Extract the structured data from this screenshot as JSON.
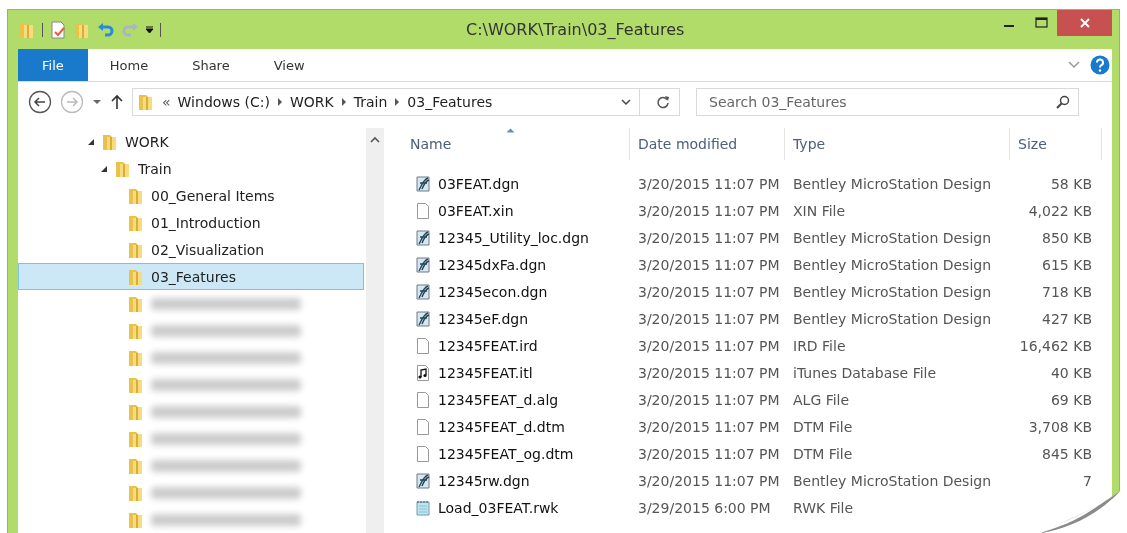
{
  "window": {
    "title": "C:\\WORK\\Train\\03_Features"
  },
  "ribbon": {
    "tabs": [
      {
        "label": "File",
        "selected": true
      },
      {
        "label": "Home",
        "selected": false
      },
      {
        "label": "Share",
        "selected": false
      },
      {
        "label": "View",
        "selected": false
      }
    ]
  },
  "address": {
    "overflow": "«",
    "crumbs": [
      "Windows (C:)",
      "WORK",
      "Train",
      "03_Features"
    ]
  },
  "search": {
    "placeholder": "Search 03_Features"
  },
  "tree": [
    {
      "label": "WORK",
      "expanded": true,
      "selected": false,
      "children": [
        {
          "label": "Train",
          "expanded": true,
          "selected": false,
          "children": [
            {
              "label": "00_General Items",
              "selected": false
            },
            {
              "label": "01_Introduction",
              "selected": false
            },
            {
              "label": "02_Visualization",
              "selected": false
            },
            {
              "label": "03_Features",
              "selected": true
            },
            {
              "kind": "blurred",
              "selected": false
            },
            {
              "kind": "blurred",
              "selected": false
            },
            {
              "kind": "blurred",
              "selected": false
            },
            {
              "kind": "blurred",
              "selected": false
            },
            {
              "kind": "blurred",
              "selected": false
            },
            {
              "kind": "blurred",
              "selected": false
            },
            {
              "kind": "blurred",
              "selected": false
            },
            {
              "kind": "blurred",
              "selected": false
            },
            {
              "kind": "blurred",
              "selected": false
            }
          ]
        }
      ]
    }
  ],
  "files": {
    "columns": [
      {
        "label": "Name",
        "sorted": true
      },
      {
        "label": "Date modified",
        "sorted": false
      },
      {
        "label": "Type",
        "sorted": false
      },
      {
        "label": "Size",
        "sorted": false
      }
    ],
    "rows": [
      {
        "kind": "design",
        "name": "03FEAT.dgn",
        "date": "3/20/2015 11:07 PM",
        "type": "Bentley MicroStation Design",
        "size": "58 KB"
      },
      {
        "kind": "blank",
        "name": "03FEAT.xin",
        "date": "3/20/2015 11:07 PM",
        "type": "XIN File",
        "size": "4,022 KB"
      },
      {
        "kind": "design",
        "name": "12345_Utility_loc.dgn",
        "date": "3/20/2015 11:07 PM",
        "type": "Bentley MicroStation Design",
        "size": "850 KB"
      },
      {
        "kind": "design",
        "name": "12345dxFa.dgn",
        "date": "3/20/2015 11:07 PM",
        "type": "Bentley MicroStation Design",
        "size": "615 KB"
      },
      {
        "kind": "design",
        "name": "12345econ.dgn",
        "date": "3/20/2015 11:07 PM",
        "type": "Bentley MicroStation Design",
        "size": "718 KB"
      },
      {
        "kind": "design",
        "name": "12345eF.dgn",
        "date": "3/20/2015 11:07 PM",
        "type": "Bentley MicroStation Design",
        "size": "427 KB"
      },
      {
        "kind": "blank",
        "name": "12345FEAT.ird",
        "date": "3/20/2015 11:07 PM",
        "type": "IRD File",
        "size": "16,462 KB"
      },
      {
        "kind": "music",
        "name": "12345FEAT.itl",
        "date": "3/20/2015 11:07 PM",
        "type": "iTunes Database File",
        "size": "40 KB"
      },
      {
        "kind": "blank",
        "name": "12345FEAT_d.alg",
        "date": "3/20/2015 11:07 PM",
        "type": "ALG File",
        "size": "69 KB"
      },
      {
        "kind": "blank",
        "name": "12345FEAT_d.dtm",
        "date": "3/20/2015 11:07 PM",
        "type": "DTM File",
        "size": "3,708 KB"
      },
      {
        "kind": "blank",
        "name": "12345FEAT_og.dtm",
        "date": "3/20/2015 11:07 PM",
        "type": "DTM File",
        "size": "845 KB"
      },
      {
        "kind": "design",
        "name": "12345rw.dgn",
        "date": "3/20/2015 11:07 PM",
        "type": "Bentley MicroStation Design",
        "size": "7"
      },
      {
        "kind": "notepad",
        "name": "Load_03FEAT.rwk",
        "date": "3/29/2015 6:00 PM",
        "type": "RWK File"
      }
    ]
  }
}
